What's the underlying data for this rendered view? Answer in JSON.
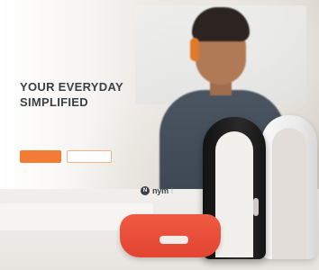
{
  "hero": {
    "title_line1": "YOUR EVERYDAY",
    "title_line2": "SIMPLIFIED",
    "subtitle": "",
    "primary_button": "",
    "secondary_button": ""
  },
  "brand": {
    "mark": "N",
    "name": "nym",
    "tail": "i"
  },
  "colors": {
    "accent": "#f27b35",
    "heading": "#3a3f45",
    "band_orange": "#e24431",
    "band_black": "#151515",
    "band_white": "#f4f4f4"
  },
  "icons": {
    "brand_mark": "nymi-logo-icon"
  }
}
